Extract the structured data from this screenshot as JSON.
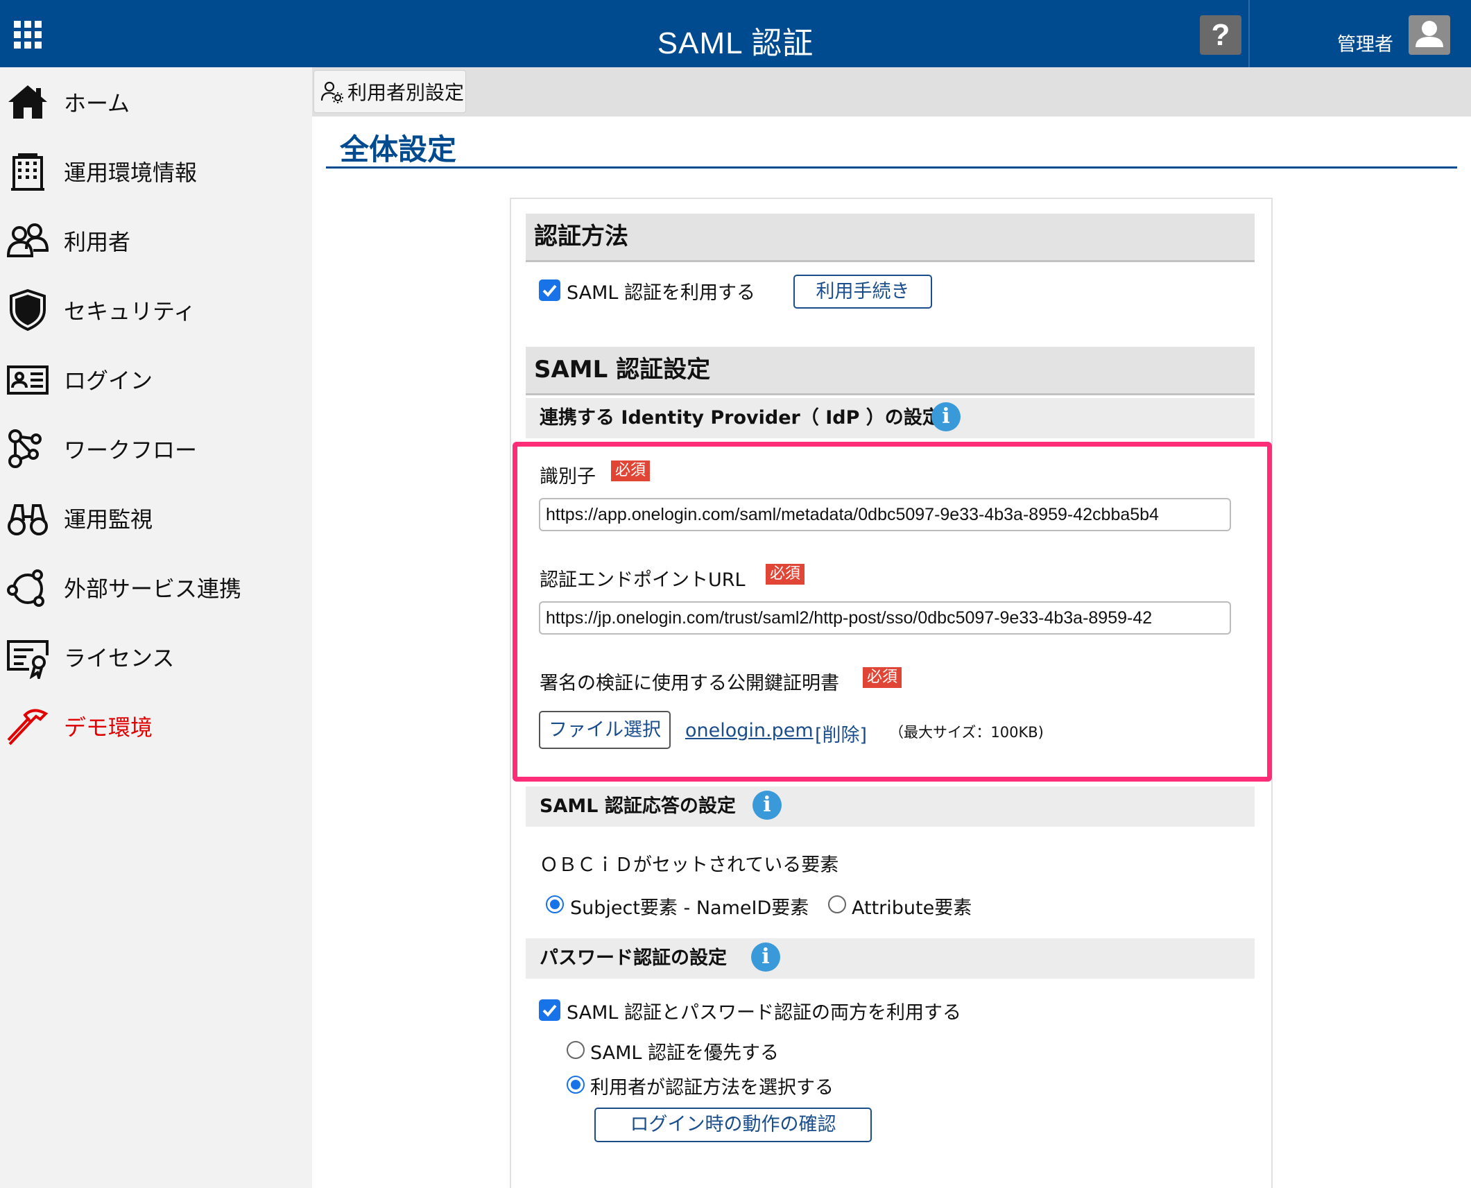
{
  "header": {
    "title": "SAML 認証",
    "help_label": "?",
    "admin_label": "管理者"
  },
  "sidebar": {
    "items": [
      {
        "label": "ホーム",
        "icon": "home-icon"
      },
      {
        "label": "運用環境情報",
        "icon": "building-icon"
      },
      {
        "label": "利用者",
        "icon": "users-icon"
      },
      {
        "label": "セキュリティ",
        "icon": "shield-icon"
      },
      {
        "label": "ログイン",
        "icon": "id-card-icon"
      },
      {
        "label": "ワークフロー",
        "icon": "workflow-icon"
      },
      {
        "label": "運用監視",
        "icon": "binoculars-icon"
      },
      {
        "label": "外部サービス連携",
        "icon": "network-icon"
      },
      {
        "label": "ライセンス",
        "icon": "certificate-icon"
      },
      {
        "label": "デモ環境",
        "icon": "hammer-icon"
      }
    ],
    "demo_color": "#e00000"
  },
  "tabs": {
    "user_settings": "利用者別設定"
  },
  "page_title": "全体設定",
  "auth_method": {
    "heading": "認証方法",
    "saml_checkbox_label": "SAML 認証を利用する",
    "saml_checked": true,
    "procedure_button": "利用手続き"
  },
  "saml_settings": {
    "heading": "SAML 認証設定",
    "idp_subheading": "連携する Identity Provider（ IdP ）の設定",
    "required_badge": "必須",
    "identifier_label": "識別子",
    "identifier_value": "https://app.onelogin.com/saml/metadata/0dbc5097-9e33-4b3a-8959-42cbba5b4",
    "endpoint_label": "認証エンドポイントURL",
    "endpoint_value": "https://jp.onelogin.com/trust/saml2/http-post/sso/0dbc5097-9e33-4b3a-8959-42",
    "cert_label": "署名の検証に使用する公開鍵証明書",
    "file_select_button": "ファイル選択",
    "file_name": "onelogin.pem",
    "delete_link": "[削除]",
    "max_size_note": "（最大サイズ：100KB)"
  },
  "response_settings": {
    "subheading": "SAML 認証応答の設定",
    "element_label": "ＯＢＣｉＤがセットされている要素",
    "options": [
      {
        "label": "Subject要素 - NameID要素",
        "selected": true
      },
      {
        "label": "Attribute要素",
        "selected": false
      }
    ]
  },
  "password_settings": {
    "subheading": "パスワード認証の設定",
    "both_checkbox_label": "SAML 認証とパスワード認証の両方を利用する",
    "both_checked": true,
    "options": [
      {
        "label": "SAML 認証を優先する",
        "selected": false
      },
      {
        "label": "利用者が認証方法を選択する",
        "selected": true
      }
    ],
    "confirm_button": "ログイン時の動作の確認"
  },
  "colors": {
    "header_bg": "#004b8f",
    "highlight_border": "#ff2d78",
    "required_badge": "#e04535",
    "accent_blue": "#1872e8"
  }
}
